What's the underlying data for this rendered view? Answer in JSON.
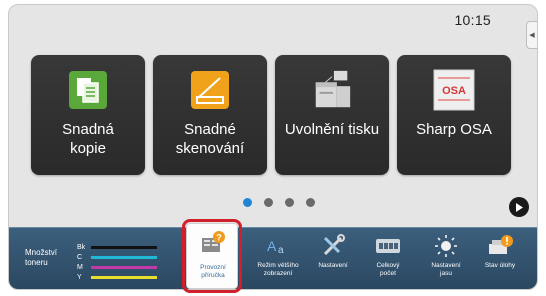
{
  "status": {
    "time": "10:15"
  },
  "tiles": [
    {
      "id": "easy-copy",
      "icon": "copy-icon",
      "label_line1": "Snadná",
      "label_line2": "kopie"
    },
    {
      "id": "easy-scan",
      "icon": "scan-icon",
      "label_line1": "Snadné",
      "label_line2": "skenování"
    },
    {
      "id": "print-release",
      "icon": "print-release-icon",
      "label_line1": "Uvolnění tisku",
      "label_line2": ""
    },
    {
      "id": "sharp-osa",
      "icon": "sharp-osa-icon",
      "label_line1": "Sharp OSA",
      "label_line2": "",
      "logo_text": "OSA"
    }
  ],
  "pager": {
    "pages": 4,
    "active": 1
  },
  "toner": {
    "title": "Množství toneru",
    "levels": [
      {
        "code": "Bk",
        "color": "#111111"
      },
      {
        "code": "C",
        "color": "#21b7d6"
      },
      {
        "code": "M",
        "color": "#c23aa7"
      },
      {
        "code": "Y",
        "color": "#e6df2e"
      }
    ]
  },
  "functions": [
    {
      "id": "operation-guide",
      "icon": "book-help-icon",
      "line1": "Provozní",
      "line2": "příručka",
      "highlighted": true
    },
    {
      "id": "large-view",
      "icon": "large-text-icon",
      "line1": "Režim většího",
      "line2": "zobrazení"
    },
    {
      "id": "settings",
      "icon": "tools-icon",
      "line1": "Nastavení",
      "line2": ""
    },
    {
      "id": "total-count",
      "icon": "counter-icon",
      "line1": "Celkový",
      "line2": "počet"
    },
    {
      "id": "brightness",
      "icon": "brightness-icon",
      "line1": "Nastavení",
      "line2": "jasu"
    },
    {
      "id": "job-status",
      "icon": "job-status-icon",
      "line1": "Stav úlohy",
      "line2": ""
    }
  ],
  "colors": {
    "highlight": "#d11f2b",
    "active_dot": "#1f86d6",
    "bottom_bar": "#2f4d66"
  }
}
